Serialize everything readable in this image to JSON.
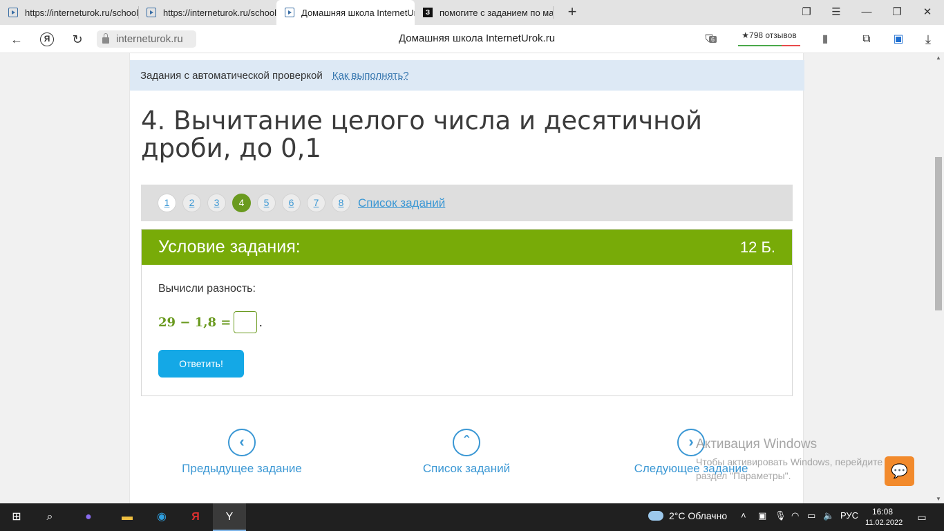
{
  "browser": {
    "tabs": [
      {
        "title": "https://interneturok.ru/school",
        "icon": "play-icon",
        "active": false
      },
      {
        "title": "https://interneturok.ru/school",
        "icon": "play-icon",
        "active": false
      },
      {
        "title": "Домашняя школа InternetUrok",
        "icon": "play-icon",
        "active": true
      },
      {
        "title": "помогите с заданием по мат",
        "icon": "znanija-icon",
        "active": false
      }
    ],
    "address": "interneturok.ru",
    "page_title": "Домашняя школа InternetUrok.ru",
    "reviews": "★798 отзывов",
    "protect_badge": "6"
  },
  "page": {
    "info_text": "Задания с автоматической проверкой",
    "info_link": "Как выполнять?",
    "task_title": "4. Вычитание целого числа и десятичной дроби, до 0,1",
    "pager": {
      "pages": [
        "1",
        "2",
        "3",
        "4",
        "5",
        "6",
        "7",
        "8"
      ],
      "current": "4",
      "list_link": "Список заданий"
    },
    "card": {
      "heading": "Условие задания:",
      "points": "12 Б.",
      "question": "Вычисли разность:",
      "expression": "29 − 1,8 =",
      "answer_value": "",
      "submit": "Ответить!"
    },
    "bottom_nav": {
      "prev": "Предыдущее задание",
      "list": "Список заданий",
      "next": "Следующее задание"
    },
    "watermark": {
      "line1": "Активация Windows",
      "line2": "Чтобы активировать Windows, перейдите в",
      "line3": "раздел \"Параметры\"."
    }
  },
  "taskbar": {
    "weather": "2°C  Облачно",
    "lang": "РУС",
    "time": "16:08",
    "date": "11.02.2022"
  },
  "colors": {
    "accent_green": "#78ab08",
    "link_blue": "#3a97d4",
    "button_blue": "#14a8e6"
  }
}
